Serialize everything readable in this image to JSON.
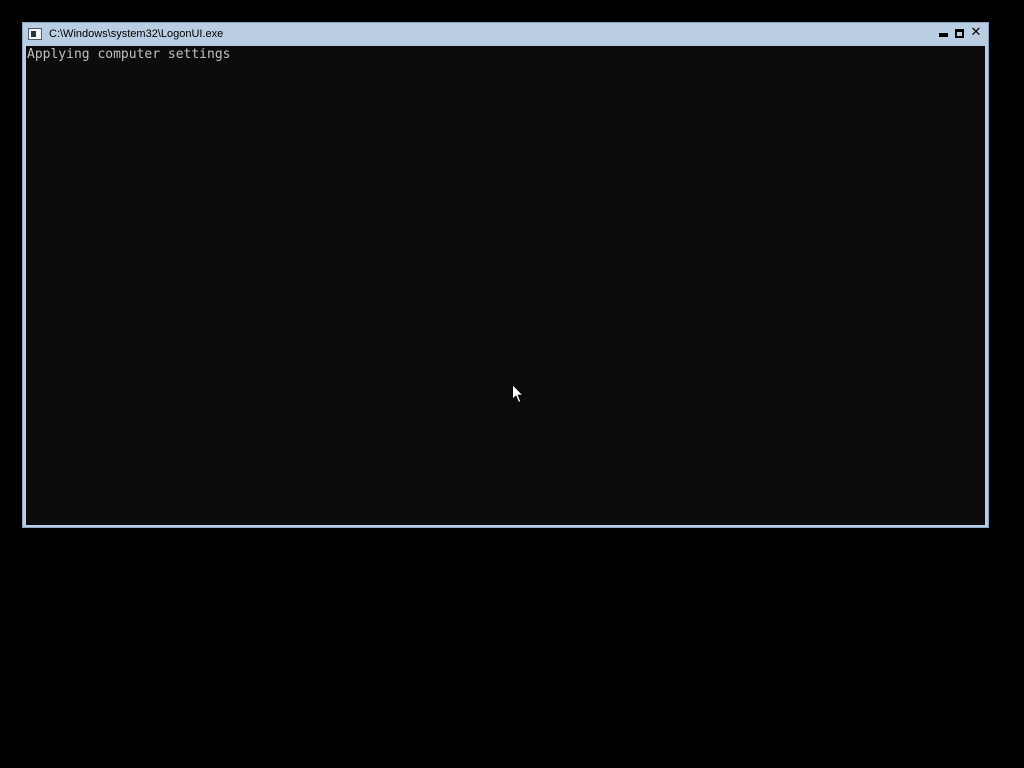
{
  "window": {
    "title": "C:\\Windows\\system32\\LogonUI.exe",
    "icon": "console-app-icon",
    "controls": {
      "minimize_icon": "minimize-icon",
      "maximize_icon": "maximize-icon",
      "close_icon": "close-icon",
      "close_glyph": "✕"
    }
  },
  "console": {
    "lines": [
      "Applying computer settings"
    ]
  },
  "cursor": {
    "icon": "arrow-cursor-icon"
  },
  "colors": {
    "desktop_background": "#000000",
    "window_frame": "#b9cde3",
    "console_background": "#0c0c0c",
    "console_text": "#c0c0c0"
  }
}
